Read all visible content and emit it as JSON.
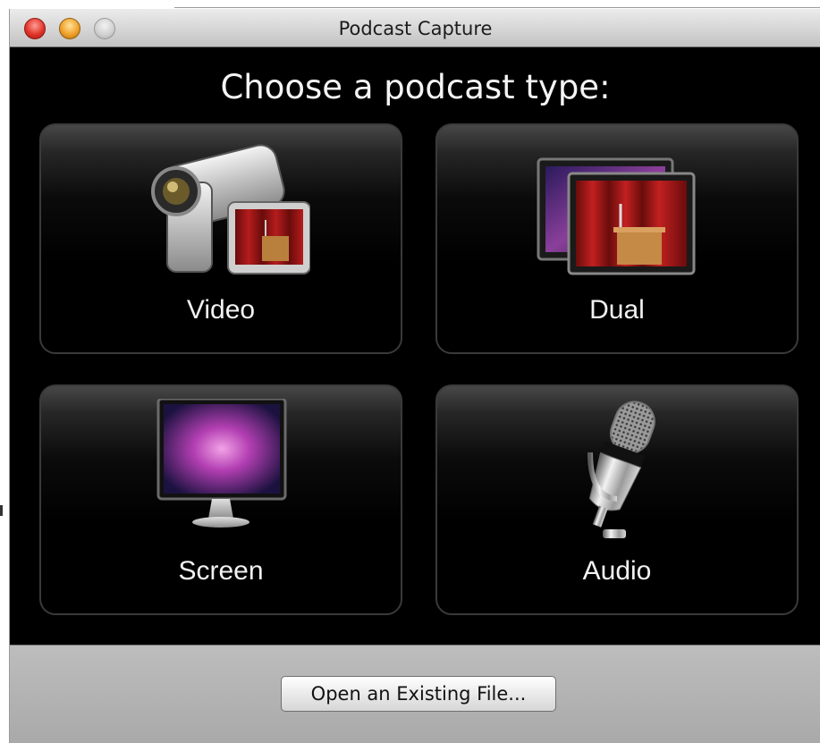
{
  "window": {
    "title": "Podcast Capture"
  },
  "heading": "Choose a podcast type:",
  "podcast_types": [
    {
      "label": "Video",
      "icon": "video-camera-icon"
    },
    {
      "label": "Dual",
      "icon": "dual-screens-icon"
    },
    {
      "label": "Screen",
      "icon": "monitor-icon"
    },
    {
      "label": "Audio",
      "icon": "microphone-icon"
    }
  ],
  "footer": {
    "open_button_label": "Open an Existing File..."
  },
  "colors": {
    "background": "#000000",
    "card_border": "#3a3a3a",
    "label_text": "#f2f2f2",
    "footer_bg": "#b3b3b3",
    "close_button": "#e0352b",
    "minimize_button": "#f0a22b",
    "zoom_button": "#cfcfcf"
  }
}
